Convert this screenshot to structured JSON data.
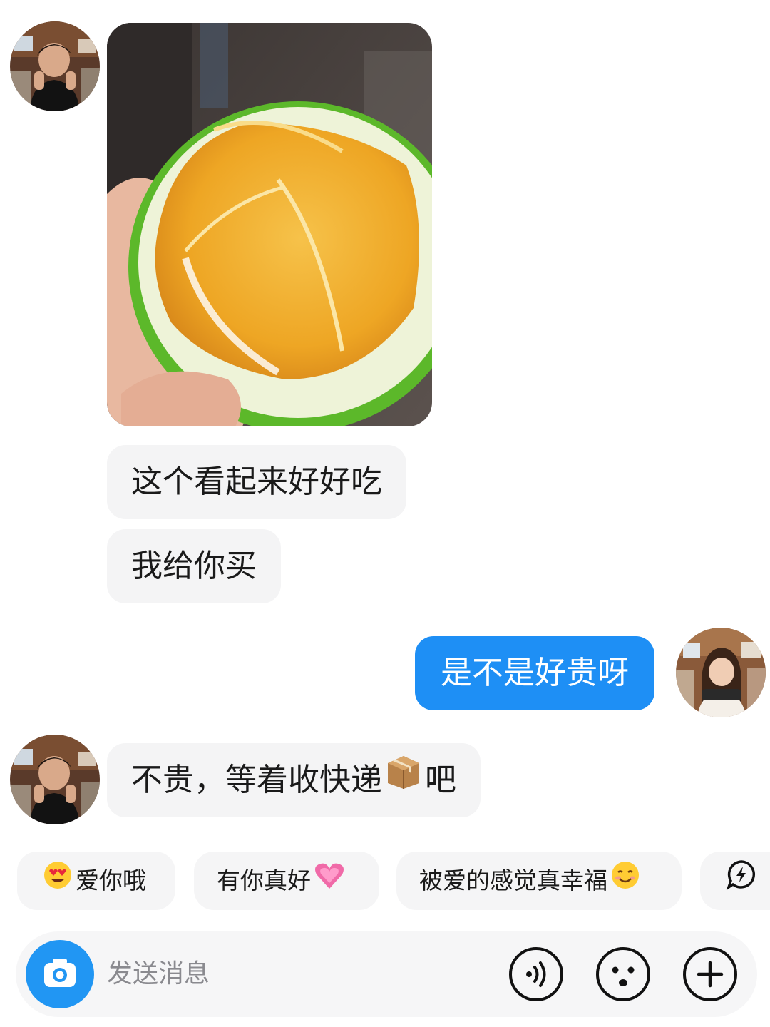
{
  "chat": {
    "messages": [
      {
        "from": "other",
        "type": "image",
        "alt": ""
      },
      {
        "from": "other",
        "type": "text",
        "text": "这个看起来好好吃"
      },
      {
        "from": "other",
        "type": "text",
        "text": "我给你买"
      },
      {
        "from": "me",
        "type": "text",
        "text": "是不是好贵呀"
      },
      {
        "from": "other",
        "type": "text",
        "text_before": "不贵，等着收快递",
        "emoji": "package-emoji",
        "text_after": "吧"
      }
    ]
  },
  "quick_replies": [
    {
      "label": "爱你哦",
      "emoji": "heart-eyes-emoji",
      "emoji_position": "before"
    },
    {
      "label": "有你真好",
      "emoji": "growing-heart-emoji",
      "emoji_position": "after"
    },
    {
      "label": "被爱的感觉真幸福",
      "emoji": "smiling-blush-emoji",
      "emoji_position": "after"
    },
    {
      "label": "",
      "icon": "bolt-chat-icon"
    }
  ],
  "composer": {
    "placeholder": "发送消息",
    "camera_icon": "camera-icon",
    "voice_icon": "voice-icon",
    "emoji_icon": "emoji-face-icon",
    "plus_icon": "plus-icon"
  },
  "colors": {
    "outgoing_bubble": "#1e8ff5",
    "incoming_bubble": "#f4f4f5",
    "camera_button": "#2196f3"
  }
}
